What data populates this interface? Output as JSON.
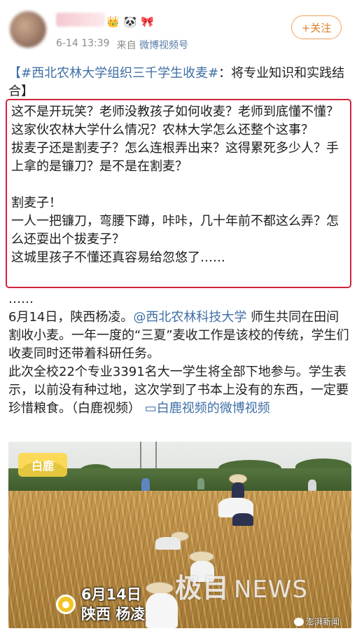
{
  "post": {
    "badges": [
      "👑",
      "🐼",
      "🎀"
    ],
    "time": "6-14 13:39",
    "source_prefix": "来自",
    "source": "微博视频号",
    "follow_label": "+关注"
  },
  "topic": {
    "hashtag": "【#西北农林大学组织三千学生收麦#",
    "rest": "：将专业知识和实践结合】"
  },
  "quote": {
    "lines_a": "这不是开玩笑？老师没教孩子如何收麦？老师到底懂不懂？这家伙农林大学什么情况？农林大学怎么还整个这事？",
    "lines_b": "拔麦子还是割麦子？怎么连根弄出来？这得累死多少人？手上拿的是镰刀？是不是在割麦？",
    "lines_c": "割麦子！",
    "lines_d": "一人一把镰刀，弯腰下蹲，咔咔，几十年前不都这么弄？怎么还耍出个拔麦子？",
    "lines_e": "这城里孩子不懂还真容易给忽悠了……"
  },
  "body": {
    "ellipsis": "……",
    "p1_start": "6月14日，陕西杨凌。",
    "mention": "@西北农林科技大学",
    "p1_end": " 师生共同在田间割收小麦。一年一度的“三夏”麦收工作是该校的传统，学生们收麦同时还带着科研任务。",
    "p2": "此次全校22个专业3391名大一学生将全部下地参与。学生表示，以前没有种过地，这次学到了书本上没有的东西，一定要珍惜粮食。（白鹿视频）",
    "video_link": "白鹿视频的微博视频"
  },
  "photo": {
    "logo": "白鹿",
    "stamp_date": "6月14日",
    "stamp_place": "陕西 杨凌",
    "watermark_main": "极目",
    "watermark_news": "NEWS",
    "credit": "澎湃新闻"
  }
}
